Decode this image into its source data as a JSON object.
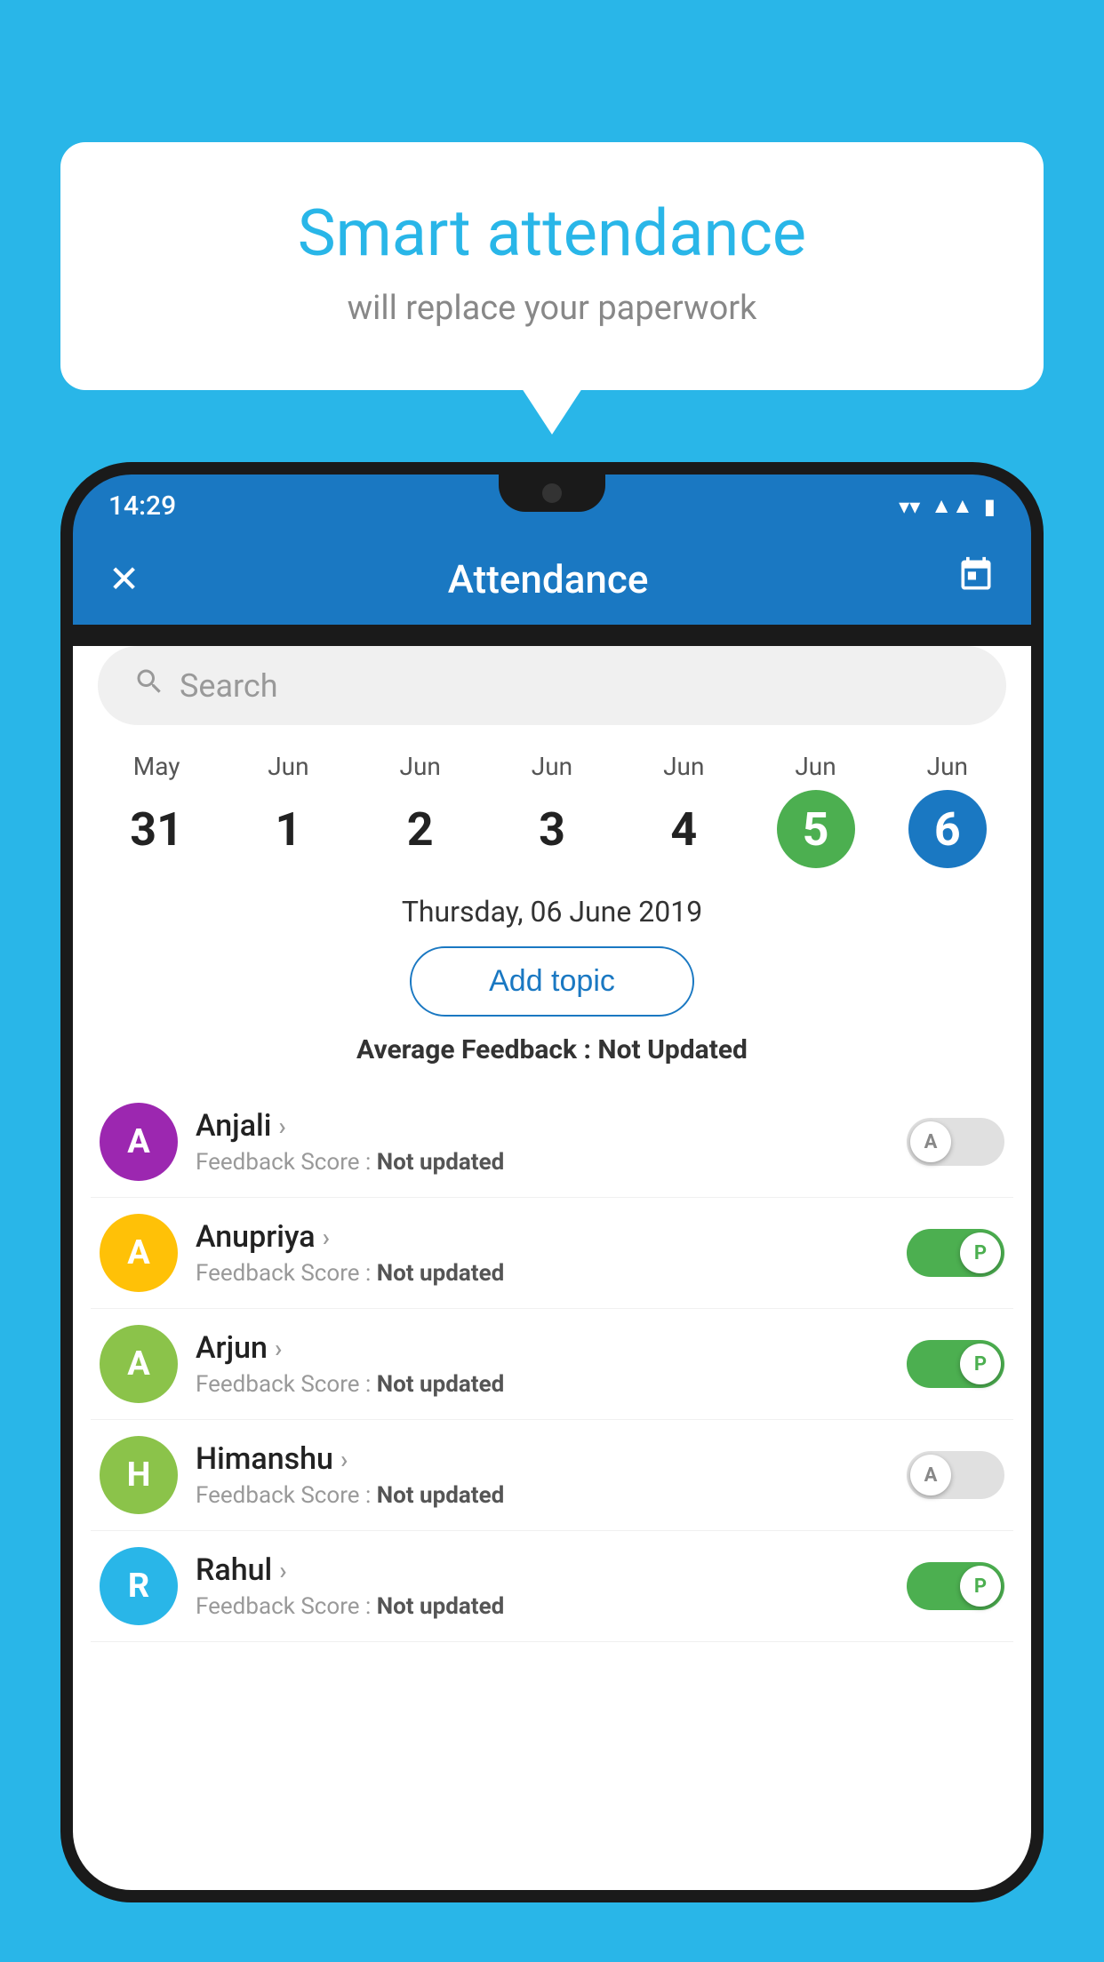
{
  "background_color": "#29b6e8",
  "bubble": {
    "title": "Smart attendance",
    "subtitle": "will replace your paperwork"
  },
  "status_bar": {
    "time": "14:29",
    "icons": [
      "wifi",
      "signal",
      "battery"
    ]
  },
  "app_bar": {
    "close_icon": "✕",
    "title": "Attendance",
    "calendar_icon": "📅"
  },
  "search": {
    "placeholder": "Search"
  },
  "dates": [
    {
      "month": "May",
      "day": "31",
      "style": "normal"
    },
    {
      "month": "Jun",
      "day": "1",
      "style": "normal"
    },
    {
      "month": "Jun",
      "day": "2",
      "style": "normal"
    },
    {
      "month": "Jun",
      "day": "3",
      "style": "normal"
    },
    {
      "month": "Jun",
      "day": "4",
      "style": "normal"
    },
    {
      "month": "Jun",
      "day": "5",
      "style": "today"
    },
    {
      "month": "Jun",
      "day": "6",
      "style": "selected"
    }
  ],
  "selected_date_text": "Thursday, 06 June 2019",
  "add_topic_label": "Add topic",
  "avg_feedback_label": "Average Feedback :",
  "avg_feedback_value": "Not Updated",
  "students": [
    {
      "name": "Anjali",
      "avatar_letter": "A",
      "avatar_color": "#9c27b0",
      "feedback_label": "Feedback Score :",
      "feedback_value": "Not updated",
      "toggle": "off",
      "toggle_letter": "A"
    },
    {
      "name": "Anupriya",
      "avatar_letter": "A",
      "avatar_color": "#ffc107",
      "feedback_label": "Feedback Score :",
      "feedback_value": "Not updated",
      "toggle": "on",
      "toggle_letter": "P"
    },
    {
      "name": "Arjun",
      "avatar_letter": "A",
      "avatar_color": "#8bc34a",
      "feedback_label": "Feedback Score :",
      "feedback_value": "Not updated",
      "toggle": "on",
      "toggle_letter": "P"
    },
    {
      "name": "Himanshu",
      "avatar_letter": "H",
      "avatar_color": "#8bc34a",
      "feedback_label": "Feedback Score :",
      "feedback_value": "Not updated",
      "toggle": "off",
      "toggle_letter": "A"
    },
    {
      "name": "Rahul",
      "avatar_letter": "R",
      "avatar_color": "#29b6e8",
      "feedback_label": "Feedback Score :",
      "feedback_value": "Not updated",
      "toggle": "on",
      "toggle_letter": "P"
    }
  ]
}
